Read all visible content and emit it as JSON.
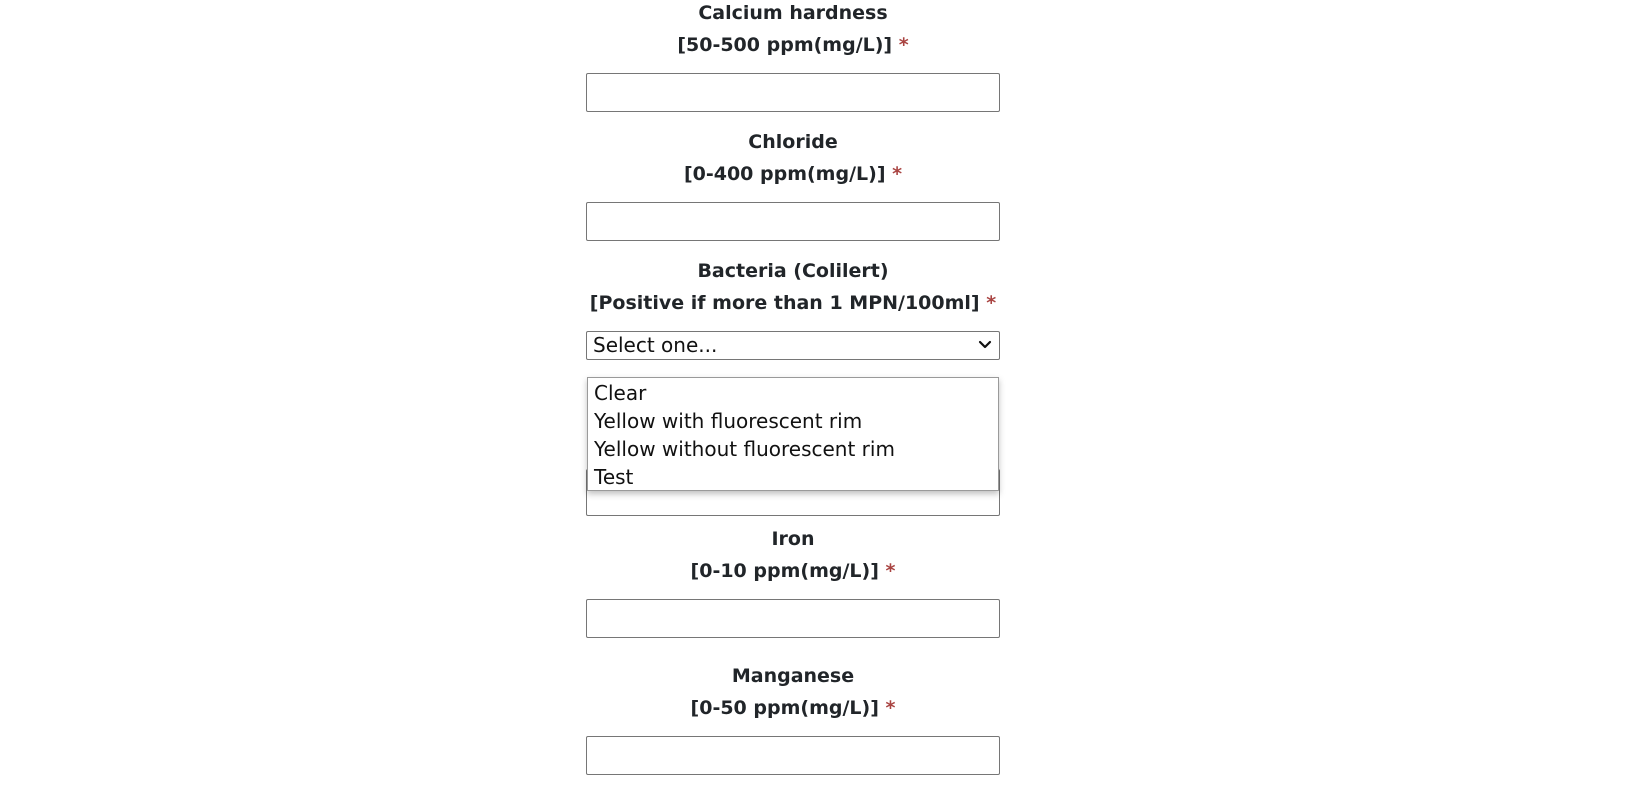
{
  "fields": [
    {
      "name": "Calcium hardness",
      "range": "[50-500 ppm(mg/L)]",
      "required_mark": "*",
      "value": ""
    },
    {
      "name": "Chloride",
      "range": "[0-400 ppm(mg/L)]",
      "required_mark": "*",
      "value": ""
    },
    {
      "name": "Bacteria (Colilert)",
      "range": "[Positive if more than 1 MPN/100ml]",
      "required_mark": "*",
      "selected": "Select one...",
      "options": [
        "Clear",
        "Yellow with fluorescent rim",
        "Yellow without fluorescent rim",
        "Test"
      ]
    },
    {
      "name": "Iron",
      "range": "[0-10 ppm(mg/L)]",
      "required_mark": "*",
      "value": ""
    },
    {
      "name": "Manganese",
      "range": "[0-50 ppm(mg/L)]",
      "required_mark": "*",
      "value": ""
    }
  ],
  "colors": {
    "required": "#a94442",
    "text": "#212529",
    "border": "#767676"
  },
  "icons": {
    "select_arrow": "chevron-down-icon"
  }
}
